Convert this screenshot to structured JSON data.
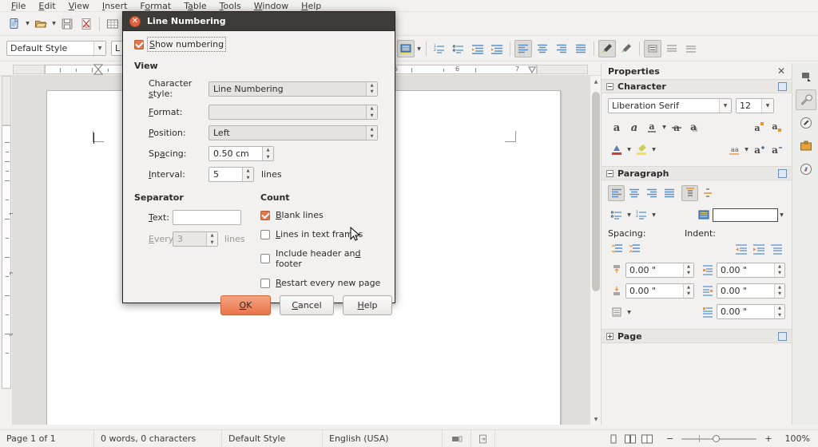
{
  "app": {
    "name": "LibreOffice Writer",
    "menus": [
      {
        "label": "File",
        "accel": "F"
      },
      {
        "label": "Edit",
        "accel": "E"
      },
      {
        "label": "View",
        "accel": "V"
      },
      {
        "label": "Insert",
        "accel": "I"
      },
      {
        "label": "Format",
        "accel": "o"
      },
      {
        "label": "Table",
        "accel": "a"
      },
      {
        "label": "Tools",
        "accel": "T"
      },
      {
        "label": "Window",
        "accel": "W"
      },
      {
        "label": "Help",
        "accel": "H"
      }
    ]
  },
  "toolbar_main": {
    "items": [
      {
        "name": "new-document-button",
        "icon": "new-doc-icon"
      },
      {
        "name": "new-document-dropdown",
        "icon": "chevron-down-icon"
      },
      {
        "name": "open-button",
        "icon": "open-folder-icon"
      },
      {
        "name": "open-dropdown",
        "icon": "chevron-down-icon"
      },
      {
        "name": "save-button",
        "icon": "save-floppy-icon"
      },
      {
        "name": "export-pdf-button",
        "icon": "pdf-icon"
      },
      {
        "name": "insert-table-button",
        "icon": "table-icon"
      },
      {
        "name": "insert-table-dropdown",
        "icon": "chevron-down-icon"
      },
      {
        "name": "insert-image-button",
        "icon": "image-icon"
      },
      {
        "name": "insert-chart-button",
        "icon": "chart-icon"
      },
      {
        "name": "insert-text-box-button",
        "icon": "text-box-icon"
      },
      {
        "name": "insert-page-break-button",
        "icon": "page-break-icon"
      },
      {
        "name": "insert-special-character-button",
        "icon": "omega-icon"
      },
      {
        "name": "insert-hyperlink-button",
        "icon": "hyperlink-icon"
      },
      {
        "name": "insert-hyperlink-dropdown",
        "icon": "chevron-down-icon"
      },
      {
        "name": "insert-comment-button",
        "icon": "comment-note-icon"
      },
      {
        "name": "show-draw-functions-button",
        "icon": "draw-functions-icon"
      }
    ]
  },
  "toolbar_format": {
    "paragraph_style": "Default Style",
    "font_name_partial": "L",
    "items": [
      {
        "name": "bullets-list-button",
        "icon": "unordered-list-icon"
      },
      {
        "name": "numbered-list-button",
        "icon": "ordered-list-icon"
      },
      {
        "name": "demote-outline-button",
        "icon": "decrease-indent-icon"
      },
      {
        "name": "promote-outline-button",
        "icon": "increase-indent-icon"
      },
      {
        "name": "align-left-button",
        "icon": "align-left-icon"
      },
      {
        "name": "align-center-button",
        "icon": "align-center-icon"
      },
      {
        "name": "align-right-button",
        "icon": "align-right-icon"
      },
      {
        "name": "align-justified-button",
        "icon": "align-justify-icon"
      },
      {
        "name": "clone-formatting-button",
        "icon": "paintbrush-icon"
      },
      {
        "name": "clear-formatting-button",
        "icon": "clear-formatting-icon"
      },
      {
        "name": "line-spacing-button",
        "icon": "line-spacing-icon"
      },
      {
        "name": "paragraph-spacing-above-button",
        "icon": "spacing-above-icon"
      },
      {
        "name": "paragraph-spacing-below-button",
        "icon": "spacing-below-icon"
      }
    ]
  },
  "ruler": {
    "horizontal_labels": [
      "5",
      "6",
      "7"
    ],
    "vertical_labels": [
      "1",
      "2",
      "3"
    ],
    "unit": "inch"
  },
  "dialog": {
    "title": "Line Numbering",
    "close_icon": "close-icon",
    "show_numbering": {
      "label": "Show numbering",
      "accel": "S",
      "checked": true
    },
    "view_group": {
      "title": "View",
      "fields": [
        {
          "label": "Character style:",
          "accel": "s",
          "value": "Line Numbering",
          "type": "combo",
          "name": "character-style-combo"
        },
        {
          "label": "Format:",
          "accel": "F",
          "value": "",
          "type": "combo",
          "name": "format-combo"
        },
        {
          "label": "Position:",
          "accel": "P",
          "value": "Left",
          "type": "combo",
          "name": "position-combo"
        },
        {
          "label": "Spacing:",
          "accel": "a",
          "value": "0.50 cm",
          "type": "spin",
          "name": "spacing-spinner"
        },
        {
          "label": "Interval:",
          "accel": "I",
          "value": "5",
          "type": "spin",
          "name": "interval-spinner",
          "suffix": "lines"
        }
      ]
    },
    "separator_group": {
      "title": "Separator",
      "text_label": "Text:",
      "text_accel": "T",
      "text_value": "",
      "every_label": "Every:",
      "every_accel": "E",
      "every_value": "3",
      "every_suffix": "lines",
      "every_disabled": true
    },
    "count_group": {
      "title": "Count",
      "options": [
        {
          "label": "Blank lines",
          "accel": "B",
          "checked": true,
          "name": "blank-lines-checkbox"
        },
        {
          "label": "Lines in text frames",
          "accel": "L",
          "checked": false,
          "name": "lines-in-text-frames-checkbox"
        },
        {
          "label": "Include header and footer",
          "accel": "d",
          "checked": false,
          "name": "include-header-and-footer-checkbox"
        },
        {
          "label": "Restart every new page",
          "accel": "R",
          "checked": false,
          "name": "restart-every-new-page-checkbox"
        }
      ]
    },
    "buttons": [
      {
        "label": "OK",
        "accel": "O",
        "name": "ok-button",
        "primary": true
      },
      {
        "label": "Cancel",
        "accel": "C",
        "name": "cancel-button",
        "primary": false
      },
      {
        "label": "Help",
        "accel": "H",
        "name": "help-button",
        "primary": false
      }
    ]
  },
  "sidebar": {
    "title": "Properties",
    "close_icon": "close-icon",
    "sections": [
      {
        "name": "character",
        "title": "Character",
        "expanded": true
      },
      {
        "name": "paragraph",
        "title": "Paragraph",
        "expanded": true
      },
      {
        "name": "page",
        "title": "Page",
        "expanded": false
      }
    ],
    "character": {
      "font_name": "Liberation Serif",
      "font_size": "12",
      "row1_icons": [
        {
          "name": "bold-button",
          "icon": "bold-a-icon"
        },
        {
          "name": "italic-button",
          "icon": "italic-a-icon"
        },
        {
          "name": "underline-button",
          "icon": "underline-a-icon"
        },
        {
          "name": "underline-dropdown",
          "icon": "chevron-down-icon"
        },
        {
          "name": "strikethrough-button",
          "icon": "strikethrough-a-icon"
        },
        {
          "name": "shadow-button",
          "icon": "shadow-a-icon"
        },
        {
          "name": "superscript-button",
          "icon": "superscript-icon"
        },
        {
          "name": "subscript-button",
          "icon": "subscript-icon"
        }
      ],
      "row2_icons": [
        {
          "name": "font-color-button",
          "icon": "font-color-icon"
        },
        {
          "name": "font-color-dropdown",
          "icon": "chevron-down-icon"
        },
        {
          "name": "highlight-color-button",
          "icon": "highlighting-color-icon"
        },
        {
          "name": "highlight-color-dropdown",
          "icon": "chevron-down-icon"
        },
        {
          "name": "character-spacing-button",
          "icon": "character-spacing-icon"
        },
        {
          "name": "character-spacing-dropdown",
          "icon": "chevron-down-icon"
        },
        {
          "name": "increase-font-size-button",
          "icon": "grow-font-icon"
        },
        {
          "name": "decrease-font-size-button",
          "icon": "shrink-font-icon"
        }
      ]
    },
    "paragraph": {
      "spacing_label": "Spacing:",
      "indent_label": "Indent:",
      "align_icons": [
        {
          "name": "align-left-button",
          "icon": "align-left-icon",
          "active": true
        },
        {
          "name": "align-center-button",
          "icon": "align-center-icon",
          "active": false
        },
        {
          "name": "align-right-button",
          "icon": "align-right-icon",
          "active": false
        },
        {
          "name": "align-justified-button",
          "icon": "align-justify-icon",
          "active": false
        },
        {
          "name": "align-top-button",
          "icon": "align-top-icon",
          "active": true
        },
        {
          "name": "align-center-vertical-button",
          "icon": "align-vcenter-icon",
          "active": false
        }
      ],
      "list_icons": [
        {
          "name": "unordered-list-button",
          "icon": "unordered-list-icon"
        },
        {
          "name": "unordered-list-dropdown",
          "icon": "chevron-down-icon"
        },
        {
          "name": "ordered-list-button",
          "icon": "ordered-list-icon"
        },
        {
          "name": "ordered-list-dropdown",
          "icon": "chevron-down-icon"
        },
        {
          "name": "background-color-button",
          "icon": "paragraph-background-icon"
        },
        {
          "name": "background-color-dropdown",
          "icon": "chevron-down-icon"
        }
      ],
      "spacing_icons": [
        {
          "name": "increase-paragraph-spacing-button",
          "icon": "increase-spacing-icon"
        },
        {
          "name": "decrease-paragraph-spacing-button",
          "icon": "decrease-spacing-icon"
        }
      ],
      "indent_icons": [
        {
          "name": "increase-indent-button",
          "icon": "increase-indent-icon"
        },
        {
          "name": "decrease-indent-button",
          "icon": "decrease-indent-icon"
        },
        {
          "name": "hanging-indent-button",
          "icon": "hanging-indent-icon"
        }
      ],
      "spacing_above": "0.00 \"",
      "spacing_below": "0.00 \"",
      "indent_before": "0.00 \"",
      "indent_after": "0.00 \"",
      "indent_first_line": "0.00 \"",
      "line_spacing_icon": "line-spacing-icon"
    },
    "tabs": [
      {
        "name": "sidebar-settings-tab",
        "icon": "sidebar-settings-icon",
        "selected": false
      },
      {
        "name": "properties-tab",
        "icon": "wrench-icon",
        "selected": true
      },
      {
        "name": "styles-tab",
        "icon": "styles-wrench-icon",
        "selected": false
      },
      {
        "name": "gallery-tab",
        "icon": "gallery-icon",
        "selected": false
      },
      {
        "name": "navigator-tab",
        "icon": "compass-icon",
        "selected": false
      }
    ]
  },
  "statusbar": {
    "page": "Page 1 of 1",
    "words": "0 words, 0 characters",
    "style": "Default Style",
    "language": "English (USA)",
    "selection_mode_icon": "selection-mode-icon",
    "save_status_icon": "unsaved-changes-icon",
    "view_layouts": [
      {
        "name": "single-page-view-button",
        "icon": "single-page-icon"
      },
      {
        "name": "multi-page-view-button",
        "icon": "multi-page-icon"
      },
      {
        "name": "book-view-button",
        "icon": "book-view-icon"
      }
    ],
    "zoom_out_label": "−",
    "zoom_in_label": "+",
    "zoom_value": "100%"
  }
}
